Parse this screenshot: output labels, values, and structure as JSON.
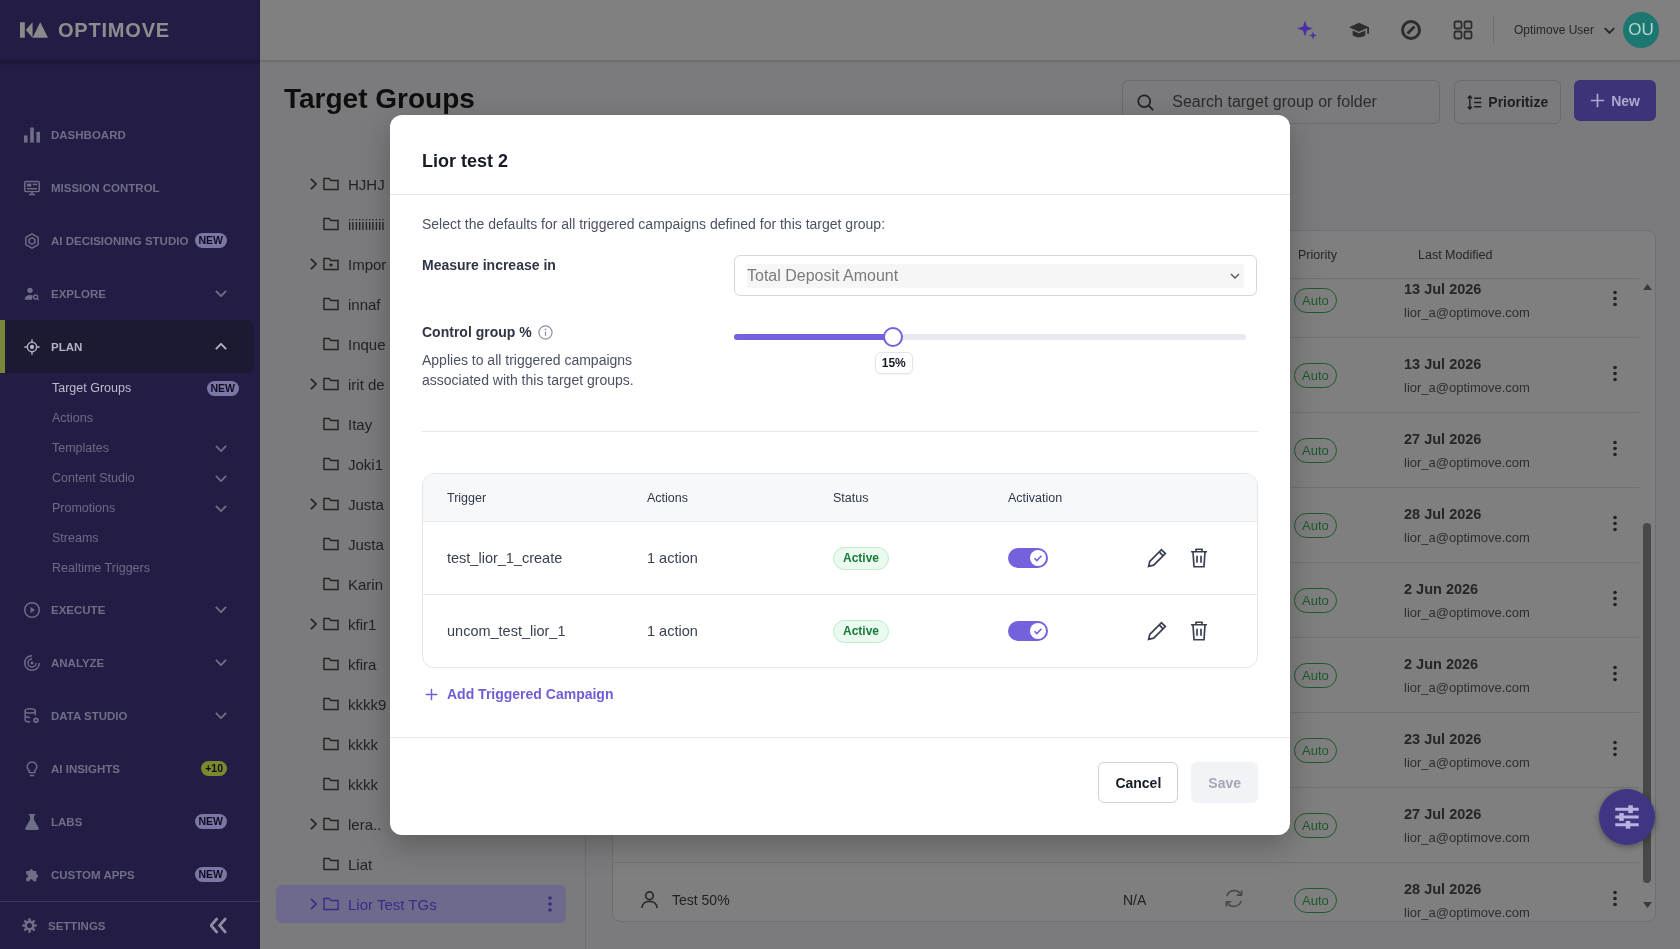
{
  "sidebar": {
    "logo": "OPTIMOVE",
    "items": [
      {
        "kind": "link",
        "label": "DASHBOARD",
        "selected": false
      },
      {
        "kind": "link",
        "label": "MISSION CONTROL",
        "selected": false
      },
      {
        "kind": "link",
        "label": "AI DECISIONING STUDIO",
        "badge": {
          "text": "NEW",
          "color": "#7a77a4"
        },
        "selected": false
      },
      {
        "kind": "group",
        "label": "EXPLORE",
        "expanded": false,
        "selected": false
      },
      {
        "kind": "group",
        "label": "PLAN",
        "expanded": true,
        "selected": true,
        "children": [
          {
            "kind": "link",
            "label": "Target Groups",
            "badge": {
              "text": "NEW",
              "color": "#7a77a4"
            },
            "selected": true
          },
          {
            "kind": "link",
            "label": "Actions",
            "selected": false
          },
          {
            "kind": "group",
            "label": "Templates",
            "expanded": false,
            "selected": false
          },
          {
            "kind": "group",
            "label": "Content Studio",
            "expanded": false,
            "selected": false
          },
          {
            "kind": "group",
            "label": "Promotions",
            "expanded": false,
            "selected": false
          },
          {
            "kind": "link",
            "label": "Streams",
            "selected": false
          },
          {
            "kind": "link",
            "label": "Realtime Triggers",
            "selected": false
          }
        ]
      },
      {
        "kind": "group",
        "label": "EXECUTE",
        "expanded": false,
        "selected": false
      },
      {
        "kind": "group",
        "label": "ANALYZE",
        "expanded": false,
        "selected": false
      },
      {
        "kind": "group",
        "label": "DATA STUDIO",
        "expanded": false,
        "selected": false
      },
      {
        "kind": "link",
        "label": "AI INSIGHTS",
        "badge": {
          "text": "+10",
          "color": "#7b892d"
        },
        "selected": false
      },
      {
        "kind": "link",
        "label": "LABS",
        "badge": {
          "text": "NEW",
          "color": "#7a77a4"
        },
        "selected": false
      },
      {
        "kind": "link",
        "label": "CUSTOM APPS",
        "badge": {
          "text": "NEW",
          "color": "#7a77a4"
        },
        "selected": false
      }
    ],
    "footer": {
      "label": "SETTINGS"
    }
  },
  "topbar": {
    "user": "Optimove User",
    "avatar": "OU"
  },
  "page": {
    "title": "Target Groups",
    "search": {
      "placeholder": "Search target group or folder"
    },
    "buttons": [
      {
        "kind": "secondary",
        "label": "Prioritize"
      },
      {
        "kind": "primary",
        "label": "New"
      }
    ]
  },
  "tree": {
    "items": [
      {
        "label": "HJHJ",
        "kind": "folder",
        "expanded": false,
        "selected": false
      },
      {
        "label": "iiiiiiiiiii",
        "kind": "folder",
        "selected": false
      },
      {
        "label": "Impor",
        "kind": "marked",
        "expanded": false,
        "selected": false
      },
      {
        "label": "innaf",
        "kind": "folder",
        "selected": false
      },
      {
        "label": "Inque",
        "kind": "folder",
        "selected": false
      },
      {
        "label": "irit de",
        "kind": "folder",
        "expanded": false,
        "selected": false
      },
      {
        "label": "Itay",
        "kind": "folder",
        "selected": false
      },
      {
        "label": "Joki1",
        "kind": "folder",
        "selected": false
      },
      {
        "label": "Justa",
        "kind": "folder",
        "expanded": false,
        "selected": false
      },
      {
        "label": "Justa",
        "kind": "folder",
        "selected": false
      },
      {
        "label": "Karin",
        "kind": "folder",
        "selected": false
      },
      {
        "label": "kfir1",
        "kind": "folder",
        "expanded": false,
        "selected": false
      },
      {
        "label": "kfira",
        "kind": "folder",
        "selected": false
      },
      {
        "label": "kkkk9",
        "kind": "folder",
        "selected": false
      },
      {
        "label": "kkkk",
        "kind": "folder",
        "selected": false
      },
      {
        "label": "kkkk",
        "kind": "folder",
        "selected": false
      },
      {
        "label": "lera..",
        "kind": "folder",
        "expanded": false,
        "selected": false
      },
      {
        "label": "Liat",
        "kind": "folder",
        "selected": false
      },
      {
        "label": "Lior Test TGs",
        "kind": "folder",
        "expanded": false,
        "selected": true
      }
    ]
  },
  "table": {
    "columns": [
      "Priority",
      "Last Modified"
    ],
    "rows": [
      {
        "priority": "Auto",
        "date": "13 Jul 2026",
        "email": "lior_a@optimove.com"
      },
      {
        "priority": "Auto",
        "date": "13 Jul 2026",
        "email": "lior_a@optimove.com"
      },
      {
        "priority": "Auto",
        "date": "27 Jul 2026",
        "email": "lior_a@optimove.com"
      },
      {
        "priority": "Auto",
        "date": "28 Jul 2026",
        "email": "lior_a@optimove.com"
      },
      {
        "priority": "Auto",
        "date": "2 Jun 2026",
        "email": "lior_a@optimove.com"
      },
      {
        "priority": "Auto",
        "date": "2 Jun 2026",
        "email": "lior_a@optimove.com"
      },
      {
        "priority": "Auto",
        "date": "23 Jul 2026",
        "email": "lior_a@optimove.com"
      },
      {
        "priority": "Auto",
        "date": "27 Jul 2026",
        "email": "lior_a@optimove.com"
      },
      {
        "column_1": "Test 50%",
        "column_2": "N/A",
        "priority": "Auto",
        "date": "28 Jul 2026",
        "email": "lior_a@optimove.com"
      }
    ]
  },
  "modal": {
    "title": "Lior test 2",
    "intro": "Select the defaults for all triggered campaigns defined for this target group:",
    "measure": {
      "label": "Measure increase in",
      "value": "Total Deposit Amount",
      "disabled": true
    },
    "control_group": {
      "label": "Control group %",
      "description": "Applies to all triggered campaigns associated with this target groups.",
      "level": 0.31,
      "reading": "15%"
    },
    "triggers": {
      "columns": [
        "Trigger",
        "Actions",
        "Status",
        "Activation"
      ],
      "rows": [
        {
          "trigger": "test_lior_1_create",
          "actions": "1 action",
          "status": "Active",
          "on": true
        },
        {
          "trigger": "uncom_test_lior_1",
          "actions": "1 action",
          "status": "Active",
          "on": true
        }
      ]
    },
    "add_link": "Add Triggered Campaign",
    "buttons": [
      {
        "label": "Cancel",
        "disabled": false
      },
      {
        "label": "Save",
        "disabled": true
      }
    ]
  }
}
